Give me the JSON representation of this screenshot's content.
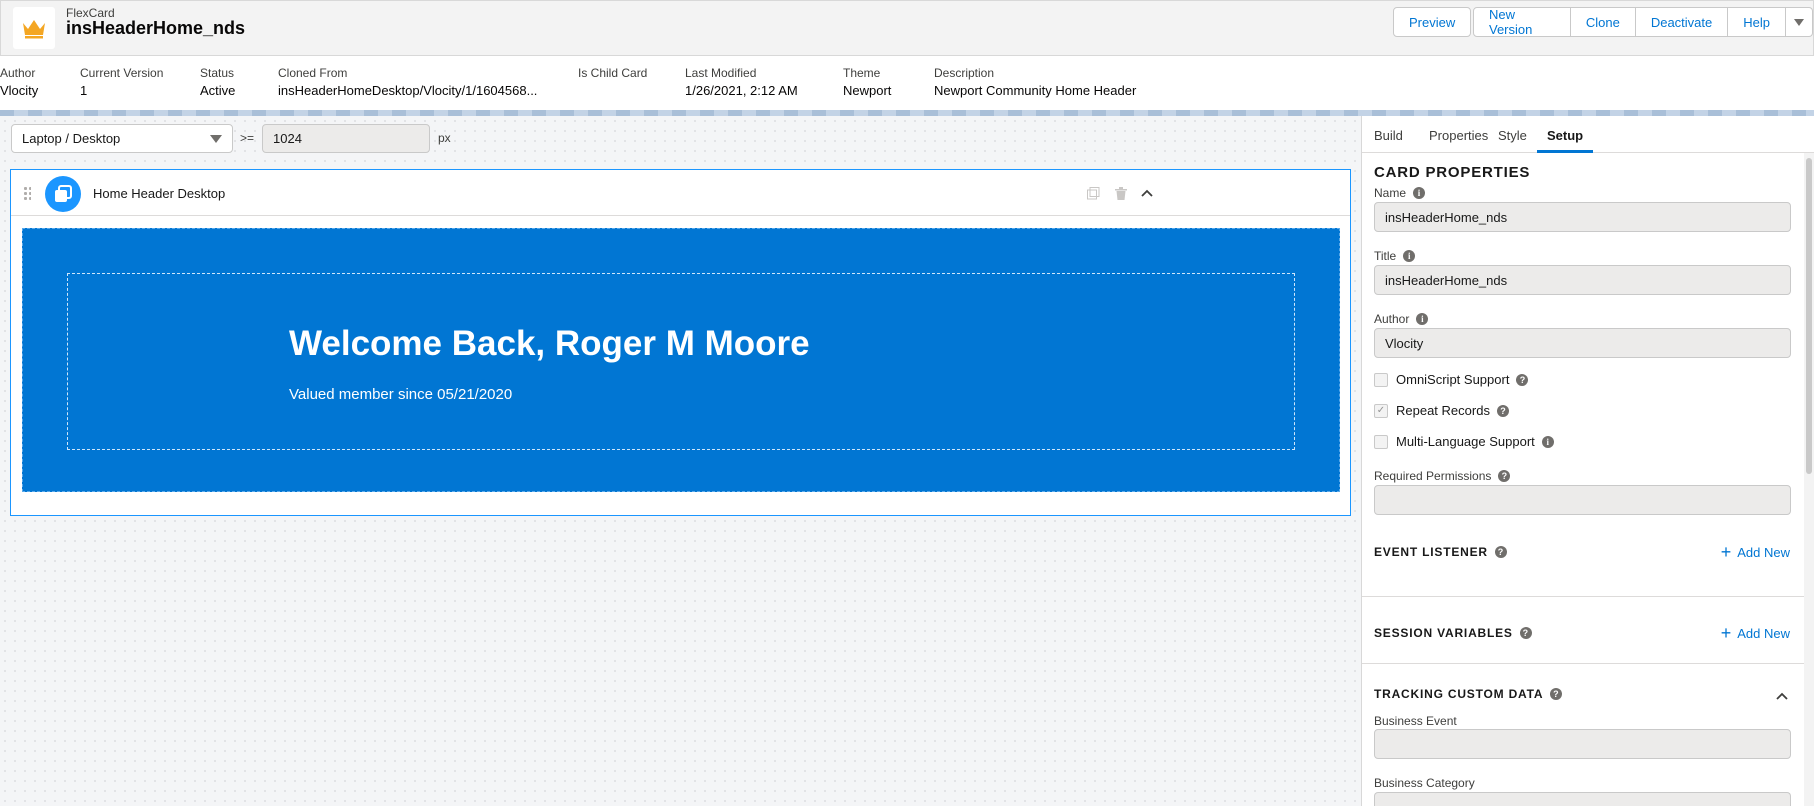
{
  "header": {
    "subtitle": "FlexCard",
    "title": "insHeaderHome_nds",
    "buttons": {
      "preview": "Preview",
      "new_version": "New Version",
      "clone": "Clone",
      "deactivate": "Deactivate",
      "help": "Help"
    },
    "logo_icon": "crown-icon",
    "logo_color": "#f4a623"
  },
  "meta": {
    "author": {
      "label": "Author",
      "value": "Vlocity"
    },
    "current_version": {
      "label": "Current Version",
      "value": "1"
    },
    "status": {
      "label": "Status",
      "value": "Active"
    },
    "cloned_from": {
      "label": "Cloned From",
      "value": "insHeaderHomeDesktop/Vlocity/1/1604568..."
    },
    "is_child_card": {
      "label": "Is Child Card",
      "value": ""
    },
    "last_modified": {
      "label": "Last Modified",
      "value": "1/26/2021, 2:12 AM"
    },
    "theme": {
      "label": "Theme",
      "value": "Newport"
    },
    "description": {
      "label": "Description",
      "value": "Newport Community Home Header"
    }
  },
  "canvas": {
    "viewport_select": "Laptop / Desktop",
    "operator": ">=",
    "width_value": "1024",
    "unit": "px",
    "card": {
      "name": "Home Header Desktop",
      "welcome": "Welcome Back, Roger M Moore",
      "member_since": "Valued member since 05/21/2020",
      "background_color": "#0176d3"
    }
  },
  "panel": {
    "tabs": [
      "Build",
      "Properties",
      "Style",
      "Setup"
    ],
    "active_tab": "Setup",
    "card_properties": {
      "title": "CARD PROPERTIES",
      "name_label": "Name",
      "name_value": "insHeaderHome_nds",
      "title_label": "Title",
      "title_value": "insHeaderHome_nds",
      "author_label": "Author",
      "author_value": "Vlocity",
      "omniscript_support": {
        "label": "OmniScript Support",
        "checked": false
      },
      "repeat_records": {
        "label": "Repeat Records",
        "checked": true
      },
      "multi_language": {
        "label": "Multi-Language Support",
        "checked": false
      },
      "required_permissions_label": "Required Permissions",
      "required_permissions_value": ""
    },
    "event_listener": {
      "title": "EVENT LISTENER",
      "add_label": "Add New"
    },
    "session_variables": {
      "title": "SESSION VARIABLES",
      "add_label": "Add New"
    },
    "tracking": {
      "title": "TRACKING CUSTOM DATA",
      "business_event_label": "Business Event",
      "business_event_value": "",
      "business_category_label": "Business Category"
    }
  }
}
